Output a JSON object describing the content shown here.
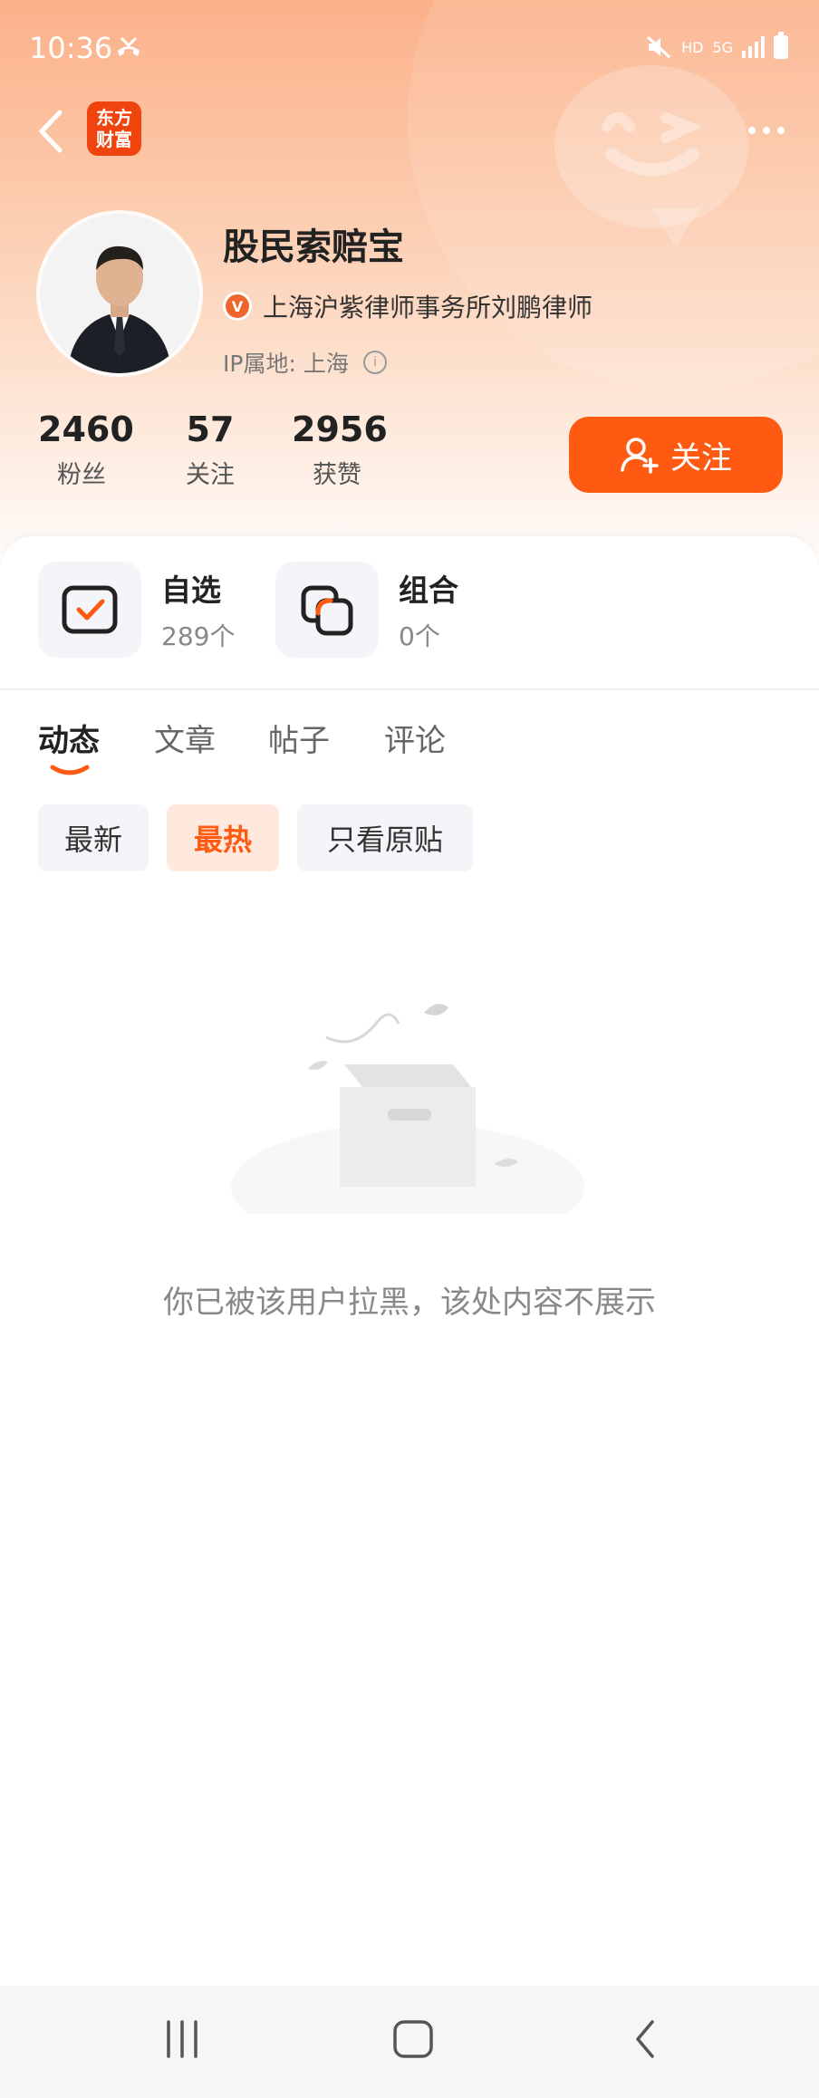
{
  "status_bar": {
    "time": "10:36",
    "hd_label": "HD",
    "network_label": "5G"
  },
  "header": {
    "logo_line1": "东方",
    "logo_line2": "财富",
    "more_icon": "more-horizontal-icon"
  },
  "profile": {
    "username": "股民索赔宝",
    "verify_badge": "V",
    "verify_text": "上海沪紫律师事务所刘鹏律师",
    "ip_label": "IP属地:",
    "ip_value": "上海",
    "info_icon": "i"
  },
  "stats": [
    {
      "value": "2460",
      "label": "粉丝"
    },
    {
      "value": "57",
      "label": "关注"
    },
    {
      "value": "2956",
      "label": "获赞"
    }
  ],
  "follow_button": {
    "label": "关注"
  },
  "sections": [
    {
      "title": "自选",
      "count": "289个"
    },
    {
      "title": "组合",
      "count": "0个"
    }
  ],
  "tabs": [
    {
      "label": "动态",
      "active": true
    },
    {
      "label": "文章",
      "active": false
    },
    {
      "label": "帖子",
      "active": false
    },
    {
      "label": "评论",
      "active": false
    }
  ],
  "filters": [
    {
      "label": "最新",
      "active": false
    },
    {
      "label": "最热",
      "active": true
    },
    {
      "label": "只看原贴",
      "active": false
    }
  ],
  "empty_state": {
    "message": "你已被该用户拉黑，该处内容不展示"
  },
  "colors": {
    "accent": "#ff5a12",
    "chip_active_bg": "#ffe9de",
    "header_gradient_top": "#fbb18a"
  }
}
